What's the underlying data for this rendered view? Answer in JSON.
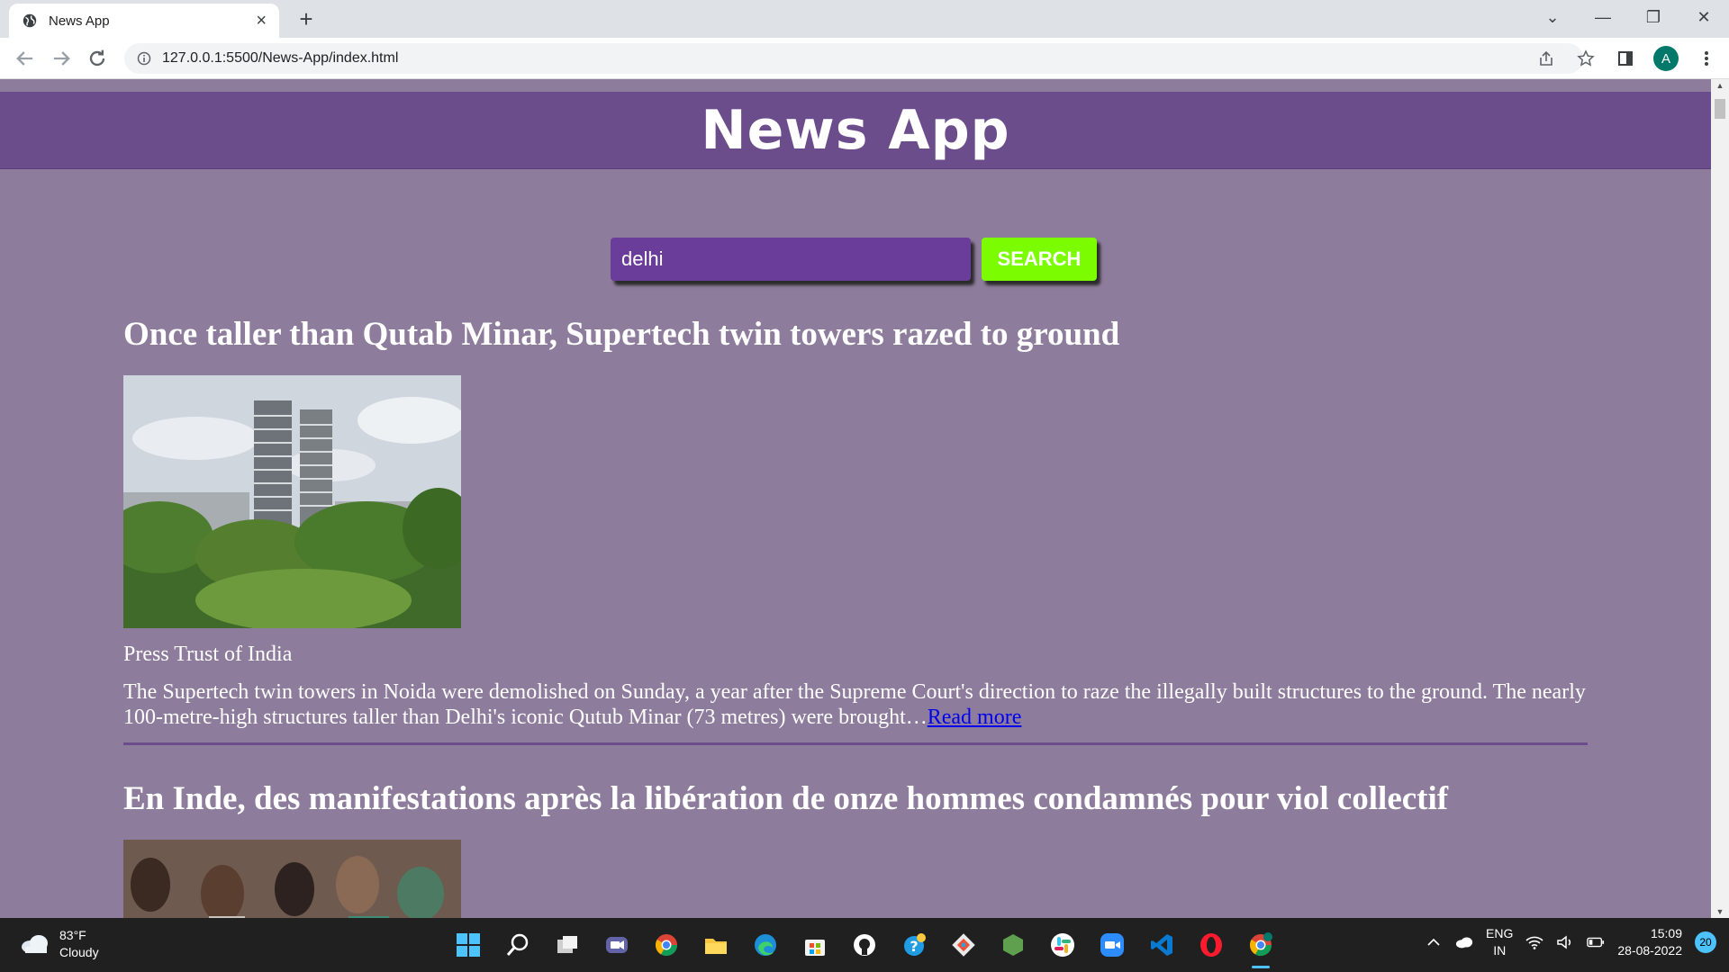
{
  "browser": {
    "tab_title": "News App",
    "url": "127.0.0.1:5500/News-App/index.html",
    "profile_initial": "A"
  },
  "page": {
    "site_title": "News App",
    "search": {
      "value": "delhi",
      "button_label": "SEARCH"
    },
    "colors": {
      "header": "#6c4d8c",
      "background": "#8e7c9c",
      "search_input": "#6a3d9a",
      "search_button": "#7cfc00",
      "link": "#0000ee"
    },
    "articles": [
      {
        "title": "Once taller than Qutab Minar, Supertech twin towers razed to ground",
        "source": "Press Trust of India",
        "description": "The Supertech twin towers in Noida were demolished on Sunday, a year after the Supreme Court's direction to raze the illegally built structures to the ground. The nearly 100-metre-high structures taller than Delhi's iconic Qutub Minar (73 metres) were brought…",
        "read_more": "Read more"
      },
      {
        "title": "En Inde, des manifestations après la libération de onze hommes condamnés pour viol collectif"
      }
    ]
  },
  "taskbar": {
    "weather_temp": "83°F",
    "weather_desc": "Cloudy",
    "lang_line1": "ENG",
    "lang_line2": "IN",
    "time": "15:09",
    "date": "28-08-2022",
    "notification_count": "20"
  }
}
